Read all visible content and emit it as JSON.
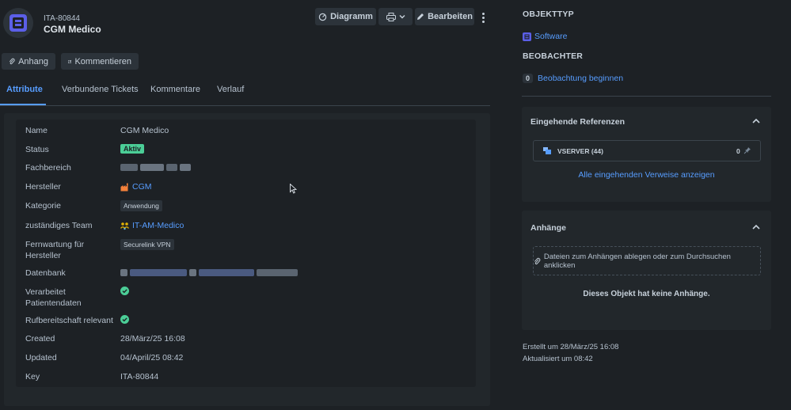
{
  "header": {
    "key": "ITA-80844",
    "name": "CGM Medico",
    "toolbar": {
      "diagram_label": "Diagramm",
      "edit_label": "Bearbeiten"
    },
    "actions": {
      "attach_label": "Anhang",
      "comment_label": "Kommentieren"
    }
  },
  "tabs": [
    {
      "label": "Attribute",
      "active": true
    },
    {
      "label": "Verbundene Tickets"
    },
    {
      "label": "Kommentare"
    },
    {
      "label": "Verlauf"
    }
  ],
  "attributes": {
    "name": {
      "label": "Name",
      "value": "CGM Medico"
    },
    "status": {
      "label": "Status",
      "value": "Aktiv"
    },
    "fachbereich": {
      "label": "Fachbereich"
    },
    "hersteller": {
      "label": "Hersteller",
      "value": "CGM"
    },
    "kategorie": {
      "label": "Kategorie",
      "value": "Anwendung"
    },
    "team": {
      "label": "zuständiges Team",
      "value": "IT-AM-Medico"
    },
    "fernwartung": {
      "label_line1": "Fernwartung für",
      "label_line2": "Hersteller",
      "value": "Securelink VPN"
    },
    "datenbank": {
      "label": "Datenbank"
    },
    "patientendaten": {
      "label_line1": "Verarbeitet",
      "label_line2": "Patientendaten"
    },
    "rufbereitschaft": {
      "label": "Rufbereitschaft relevant"
    },
    "created": {
      "label": "Created",
      "value": "28/März/25 16:08"
    },
    "updated": {
      "label": "Updated",
      "value": "04/April/25 08:42"
    },
    "key": {
      "label": "Key",
      "value": "ITA-80844"
    }
  },
  "sidebar": {
    "objekttyp_heading": "OBJEKTTYP",
    "objekttyp_value": "Software",
    "beobachter_heading": "BEOBACHTER",
    "watch_count": "0",
    "watch_label": "Beobachtung beginnen",
    "incoming": {
      "title": "Eingehende Referenzen",
      "row_label": "VSERVER (44)",
      "row_count": "0",
      "show_all": "Alle eingehenden Verweise anzeigen"
    },
    "attachments": {
      "title": "Anhänge",
      "drop_text": "Dateien zum Anhängen ablegen oder zum Durchsuchen anklicken",
      "empty_text": "Dieses Objekt hat keine Anhänge."
    },
    "created_text": "Erstellt um 28/März/25 16:08",
    "updated_text": "Aktualisiert um 08:42"
  },
  "colors": {
    "accent": "#579dff",
    "success": "#4bce97",
    "brand": "#6366f1"
  }
}
